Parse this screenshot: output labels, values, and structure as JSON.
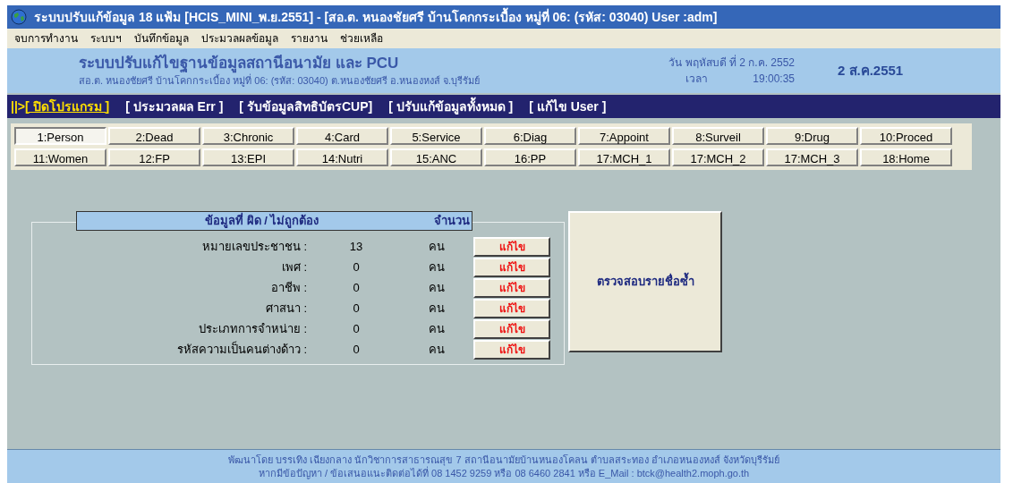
{
  "window": {
    "title": "ระบบปรับแก้ข้อมูล 18 แฟ้ม [HCIS_MINI_พ.ย.2551] - [สอ.ต.  หนองชัยศรี บ้านโคกกระเบื้อง หมู่ที่ 06: (รหัส: 03040) User :adm]"
  },
  "menu": [
    "จบการทำงาน",
    "ระบบฯ",
    "บันทึกข้อมูล",
    "ประมวลผลข้อมูล",
    "รายงาน",
    "ช่วยเหลือ"
  ],
  "header": {
    "title": "ระบบปรับแก้ไขฐานข้อมูลสถานีอนามัย และ PCU",
    "subtitle": "สอ.ต. หนองชัยศรี บ้านโคกกระเบื้อง หมู่ที่ 06: (รหัส: 03040) ต.หนองชัยศรี อ.หนองหงส์  จ.บุรีรัมย์",
    "date_line": "วัน พฤหัสบดี ที่ 2 ก.ค. 2552",
    "time_label": "เวลา",
    "time": "19:00:35",
    "big_date": "2 ส.ค.2551"
  },
  "toolbar": {
    "prefix": "||>",
    "items": [
      {
        "label": "[ ปิดโปรแกรม ]",
        "kind": "link"
      },
      {
        "label": "[ ประมวลผล Err ]",
        "kind": "plain"
      },
      {
        "label": "[ รับข้อมูลสิทธิบัตรCUP]",
        "kind": "plain"
      },
      {
        "label": "[ ปรับแก้ข้อมูลทั้งหมด ]",
        "kind": "plain"
      },
      {
        "label": "[ แก้ไข User ]",
        "kind": "plain"
      }
    ]
  },
  "tabs": [
    {
      "label": "1:Person",
      "selected": true
    },
    {
      "label": "2:Dead",
      "selected": false
    },
    {
      "label": "3:Chronic",
      "selected": false
    },
    {
      "label": "4:Card",
      "selected": false
    },
    {
      "label": "5:Service",
      "selected": false
    },
    {
      "label": "6:Diag",
      "selected": false
    },
    {
      "label": "7:Appoint",
      "selected": false
    },
    {
      "label": "8:Surveil",
      "selected": false
    },
    {
      "label": "9:Drug",
      "selected": false
    },
    {
      "label": "10:Proced",
      "selected": false
    },
    {
      "label": "11:Women",
      "selected": false
    },
    {
      "label": "12:FP",
      "selected": false
    },
    {
      "label": "13:EPI",
      "selected": false
    },
    {
      "label": "14:Nutri",
      "selected": false
    },
    {
      "label": "15:ANC",
      "selected": false
    },
    {
      "label": "16:PP",
      "selected": false
    },
    {
      "label": "17:MCH_1",
      "selected": false
    },
    {
      "label": "17:MCH_2",
      "selected": false
    },
    {
      "label": "17:MCH_3",
      "selected": false
    },
    {
      "label": "18:Home",
      "selected": false
    }
  ],
  "errors": {
    "heading": "ข้อมูลที่ ผิด / ไม่ถูกต้อง",
    "count_heading": "จำนวน",
    "rows": [
      {
        "label": "หมายเลขประชาชน :",
        "count": "13",
        "unit": "คน",
        "button": "แก้ไข"
      },
      {
        "label": "เพศ :",
        "count": "0",
        "unit": "คน",
        "button": "แก้ไข"
      },
      {
        "label": "อาชีพ :",
        "count": "0",
        "unit": "คน",
        "button": "แก้ไข"
      },
      {
        "label": "ศาสนา :",
        "count": "0",
        "unit": "คน",
        "button": "แก้ไข"
      },
      {
        "label": "ประเภทการจำหน่าย :",
        "count": "0",
        "unit": "คน",
        "button": "แก้ไข"
      },
      {
        "label": "รหัสความเป็นคนต่างด้าว :",
        "count": "0",
        "unit": "คน",
        "button": "แก้ไข"
      }
    ],
    "check_button": "ตรวจสอบรายชื่อซ้ำ"
  },
  "footer": [
    "พัฒนาโดย บรรเทิง เฉียงกลาง  นักวิชาการสาธารณสุข 7 สถานีอนามัยบ้านหนองโคลน  ตำบลสระทอง  อำเภอหนองหงส์  จังหวัดบุรีรัมย์",
    "หากมีข้อปัญหา / ข้อเสนอแนะติดต่อได้ที่ 08 1452 9259 หรือ 08 6460 2841 หรือ  E_Mail : btck@health2.moph.go.th"
  ]
}
